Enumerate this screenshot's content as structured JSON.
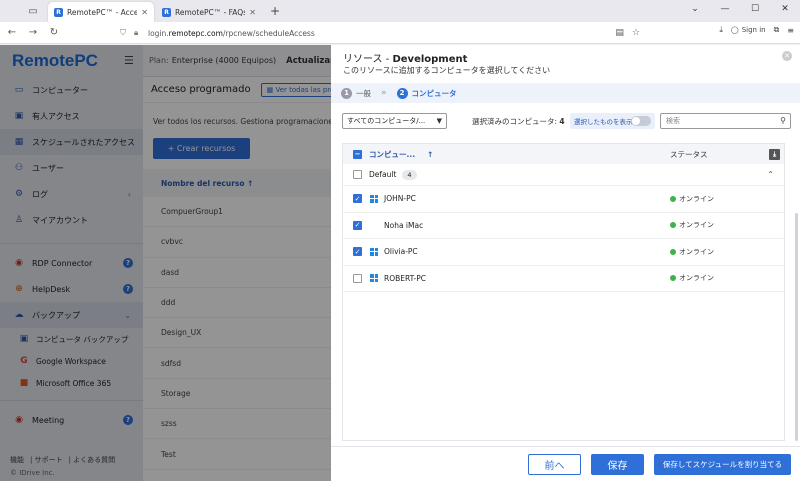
{
  "browser": {
    "tabs": [
      {
        "title": "RemotePC™ - Acceso programado",
        "active": true
      },
      {
        "title": "RemotePC™ - FAQs on Remote Ac",
        "active": false
      }
    ],
    "url_prefix": "login.",
    "url_domain": "remotepc.com",
    "url_path": "/rpcnew/scheduleAccess",
    "sign_in": "Sign in"
  },
  "sidebar": {
    "brand": "RemotePC",
    "items": [
      {
        "label": "コンピューター",
        "icon": "monitor-icon"
      },
      {
        "label": "有人アクセス",
        "icon": "attended-icon"
      },
      {
        "label": "スケジュールされたアクセス",
        "icon": "calendar-icon",
        "active": true
      },
      {
        "label": "ユーザー",
        "icon": "users-icon"
      },
      {
        "label": "ログ",
        "icon": "log-icon"
      },
      {
        "label": "マイアカウント",
        "icon": "account-icon"
      }
    ],
    "tools": [
      {
        "label": "RDP Connector"
      },
      {
        "label": "HelpDesk"
      },
      {
        "label": "バックアップ"
      }
    ],
    "backup_sub": [
      "コンピュータ バックアップ",
      "Google Workspace",
      "Microsoft Office 365"
    ],
    "meeting": "Meeting",
    "footer_links": [
      "機能",
      "サポート",
      "よくある質問"
    ],
    "copyright": "© IDrive Inc."
  },
  "main": {
    "plan_label": "Plan:",
    "plan_value": "Enterprise (4000 Equipos)",
    "upgrade": "Actualizar de",
    "page_title": "Acceso programado",
    "view_all": "Ver todas las progra",
    "description": "Ver todos los recursos. Gestiona programaciones, u",
    "create_button": "+ Crear recursos",
    "col_header": "Nombre del recurso ↑",
    "rows": [
      "CompuerGroup1",
      "cvbvc",
      "dasd",
      "ddd",
      "Design_UX",
      "sdfsd",
      "Storage",
      "szss",
      "Test"
    ]
  },
  "modal": {
    "title_prefix": "リソース - ",
    "title_name": "Development",
    "subtitle": "このリソースに追加するコンピュータを選択してください",
    "steps": [
      {
        "num": "1",
        "label": "一般"
      },
      {
        "num": "2",
        "label": "コンピュータ"
      }
    ],
    "filter_dropdown": "すべてのコンピュータ/...",
    "selected_label": "選択済みのコンピュータ:",
    "selected_count": "4",
    "show_selected": "選択したものを表示",
    "search_placeholder": "検索",
    "col_computer": "コンピュー...",
    "col_status": "ステータス",
    "group_name": "Default",
    "group_count": "4",
    "computers": [
      {
        "name": "JOHN-PC",
        "os": "windows-icon",
        "checked": true,
        "status": "オンライン"
      },
      {
        "name": "Noha iMac",
        "os": "apple-icon",
        "checked": true,
        "status": "オンライン"
      },
      {
        "name": "Olivia-PC",
        "os": "windows-icon",
        "checked": true,
        "status": "オンライン"
      },
      {
        "name": "ROBERT-PC",
        "os": "windows-icon",
        "checked": false,
        "status": "オンライン"
      }
    ],
    "status_color": "#3cb44b",
    "btn_prev": "前へ",
    "btn_save": "保存",
    "btn_save_schedule": "保存してスケジュールを割り当てる"
  },
  "colors": {
    "accent": "#2f6fd8"
  }
}
